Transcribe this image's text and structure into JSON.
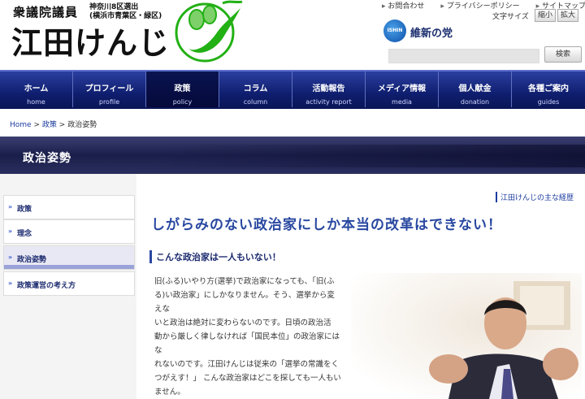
{
  "header": {
    "role": "衆議院議員",
    "district_line1": "神奈川8区選出",
    "district_line2": "(横浜市青葉区・緑区)",
    "name": "江田けんじ",
    "top_links": [
      "お問合わせ",
      "プライバシーポリシー",
      "サイトマップ"
    ],
    "font_size_label": "文字サイズ",
    "font_small": "縮小",
    "font_large": "拡大",
    "party_logo_text": "ISHIN",
    "party_name": "維新の党",
    "search_input_value": "",
    "search_button": "検索"
  },
  "nav": {
    "items": [
      {
        "jp": "ホーム",
        "en": "home"
      },
      {
        "jp": "プロフィール",
        "en": "profile"
      },
      {
        "jp": "政策",
        "en": "policy"
      },
      {
        "jp": "コラム",
        "en": "column"
      },
      {
        "jp": "活動報告",
        "en": "activity report"
      },
      {
        "jp": "メディア情報",
        "en": "media"
      },
      {
        "jp": "個人献金",
        "en": "donation"
      },
      {
        "jp": "各種ご案内",
        "en": "guides"
      }
    ],
    "active_index": 2
  },
  "breadcrumb": {
    "home": "Home",
    "sep": ">",
    "policy": "政策",
    "current": "政治姿勢"
  },
  "page_title": "政治姿勢",
  "sidebar": {
    "items": [
      {
        "label": "政策"
      },
      {
        "label": "理念"
      },
      {
        "label": "政治姿勢"
      },
      {
        "label": "政策運営の考え方"
      }
    ],
    "active_index": 2
  },
  "main": {
    "profile_link": "江田けんじの主な経歴",
    "headline": "しがらみのない政治家にしか本当の改革はできない！",
    "subheading": "こんな政治家は一人もいない！",
    "body": [
      "旧(ふる)いやり方(選挙)で政治家になっても、「旧(ふ",
      "る)い政治家」にしかなりません。そう、選挙から変えな",
      "いと政治は絶対に変わらないのです。日頃の政治活",
      "動から厳しく律しなければ「国民本位」の政治家にはな",
      "れないのです。江田けんじは従来の「選挙の常識をく",
      "つがえす！」 こんな政治家はどこを探しても一人もい",
      "ません。"
    ]
  },
  "colors": {
    "nav": "#0f1e6e",
    "accent": "#2847a0",
    "bean_green": "#22b014"
  }
}
